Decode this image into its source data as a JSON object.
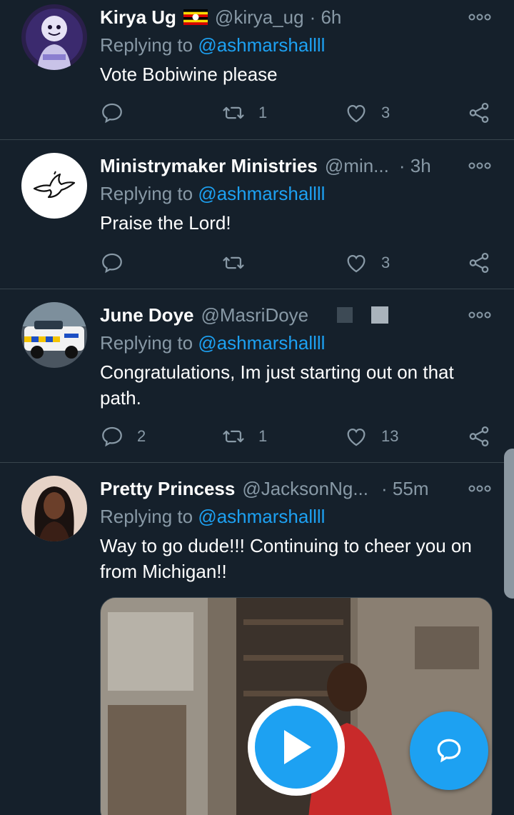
{
  "colors": {
    "background": "#15202b",
    "accent": "#1da1f2",
    "secondary_text": "#8899a6",
    "divider": "#38444d"
  },
  "tweets": [
    {
      "name": "Kirya Ug",
      "flag": "uganda-flag",
      "handle": "@kirya_ug",
      "time": "· 6h",
      "replying_label": "Replying to",
      "mention": "@ashmarshallll",
      "text": "Vote Bobiwine please",
      "reply_count": "",
      "retweet_count": "1",
      "like_count": "3"
    },
    {
      "name": "Ministrymaker Ministries",
      "handle": "@min...",
      "time": "· 3h",
      "replying_label": "Replying to",
      "mention": "@ashmarshallll",
      "text": "Praise the Lord!",
      "reply_count": "",
      "retweet_count": "",
      "like_count": "3"
    },
    {
      "name": "June Doye",
      "handle": "@MasriDoye",
      "time": "",
      "replying_label": "Replying to",
      "mention": "@ashmarshallll",
      "text": "Congratulations, Im just starting out on that path.",
      "reply_count": "2",
      "retweet_count": "1",
      "like_count": "13"
    },
    {
      "name": "Pretty Princess",
      "handle": "@JacksonNg...",
      "time": "· 55m",
      "replying_label": "Replying to",
      "mention": "@ashmarshallll",
      "text": "Way to go dude!!! Continuing to cheer you on from Michigan!!",
      "media": "video"
    }
  ],
  "icons": {
    "reply": "reply-icon",
    "retweet": "retweet-icon",
    "like": "heart-icon",
    "share": "share-icon",
    "more": "more-icon",
    "play": "play-icon",
    "compose": "compose-reply-icon"
  }
}
